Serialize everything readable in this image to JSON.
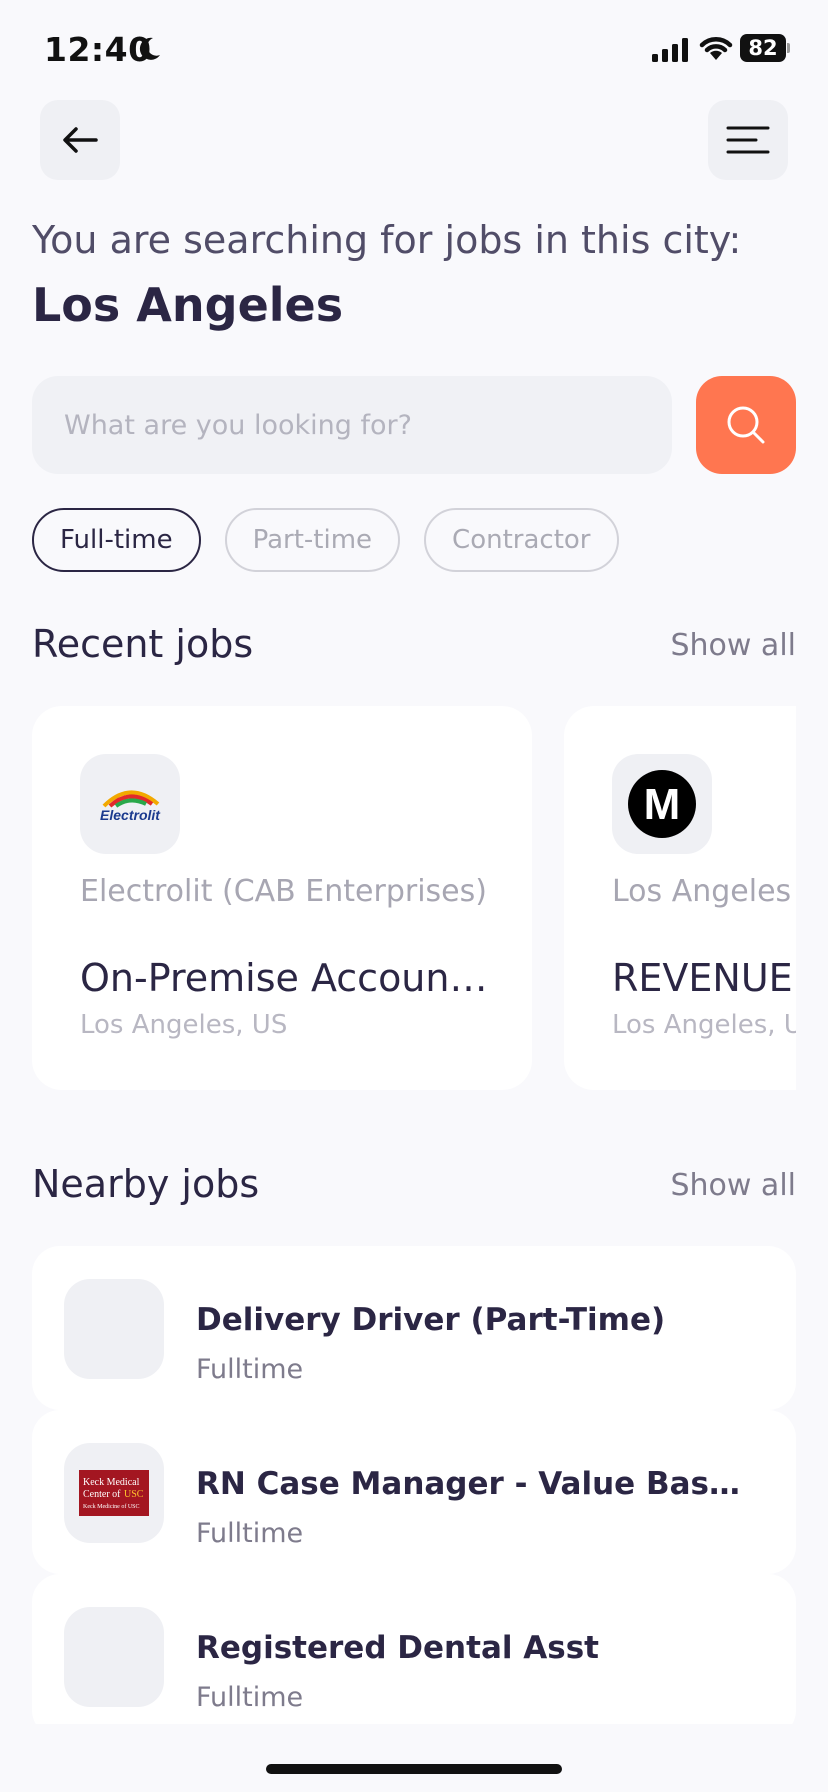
{
  "status_bar": {
    "time": "12:40",
    "battery": "82"
  },
  "header": {
    "subtitle": "You are searching for jobs in this city:",
    "city": "Los Angeles"
  },
  "search": {
    "placeholder": "What are you looking for?"
  },
  "filters": [
    {
      "label": "Full-time",
      "active": true
    },
    {
      "label": "Part-time",
      "active": false
    },
    {
      "label": "Contractor",
      "active": false
    }
  ],
  "recent": {
    "title": "Recent jobs",
    "show_all": "Show all",
    "items": [
      {
        "logo_text": "Electrolit",
        "company": "Electrolit (CAB Enterprises)",
        "title": "On-Premise Account Manager",
        "location": "Los Angeles, US"
      },
      {
        "logo_text": "M",
        "company": "Los Angeles",
        "title": "REVENUE",
        "location": "Los Angeles, US"
      }
    ]
  },
  "nearby": {
    "title": "Nearby jobs",
    "show_all": "Show all",
    "items": [
      {
        "title": "Delivery Driver (Part-Time)",
        "type": "Fulltime"
      },
      {
        "title": "RN Case Manager - Value Based Care",
        "type": "Fulltime",
        "logo_lines": [
          "Keck Medical",
          "Center of",
          "USC",
          "Keck Medicine of USC"
        ]
      },
      {
        "title": "Registered Dental Asst",
        "type": "Fulltime"
      }
    ]
  },
  "colors": {
    "accent": "#ff7650",
    "primary_text": "#2b2644",
    "page_bg": "#f9f9fc",
    "card_bg": "#ffffff",
    "logo_bg": "#eff0f4"
  }
}
